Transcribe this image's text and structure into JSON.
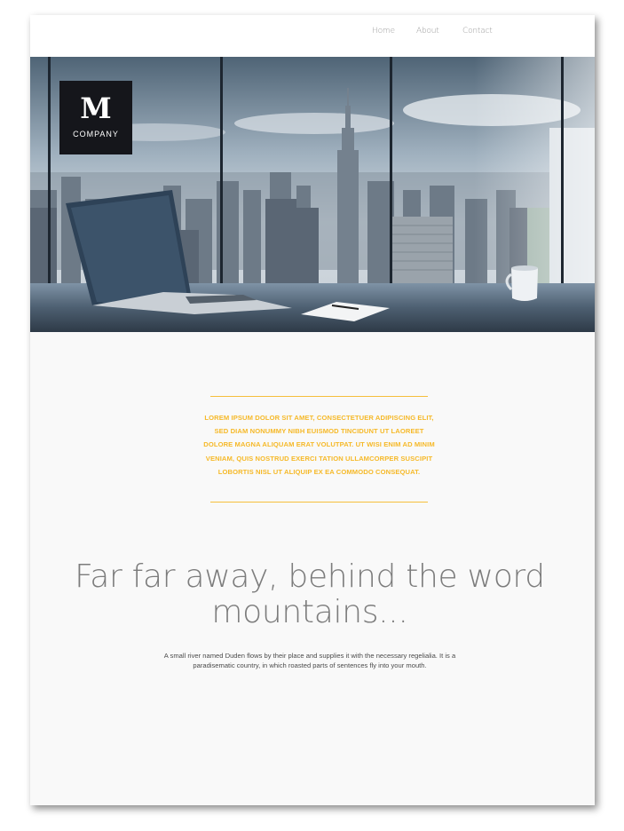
{
  "nav": {
    "items": [
      {
        "label": "Home"
      },
      {
        "label": "About"
      },
      {
        "label": "Contact"
      }
    ]
  },
  "logo": {
    "letter": "M",
    "word": "COMPANY"
  },
  "hero": {
    "image": "office-desk-city-skyline-image"
  },
  "intro": {
    "text": "LOREM IPSUM DOLOR SIT AMET, CONSECTETUER ADIPISCING ELIT, SED DIAM NONUMMY NIBH EUISMOD TINCIDUNT UT LAOREET DOLORE MAGNA ALIQUAM ERAT VOLUTPAT.  UT WISI ENIM AD MINIM VENIAM, QUIS NOSTRUD EXERCI TATION ULLAMCORPER SUSCIPIT LOBORTIS NISL UT ALIQUIP EX EA COMMODO CONSEQUAT.",
    "accent_color": "#f6b928"
  },
  "main": {
    "headline": "Far far away, behind the word mountains...",
    "body": "A small river named Duden flows by their place and supplies it with the necessary regelialia. It is a paradisematic country, in which roasted parts of sentences fly into your mouth."
  }
}
